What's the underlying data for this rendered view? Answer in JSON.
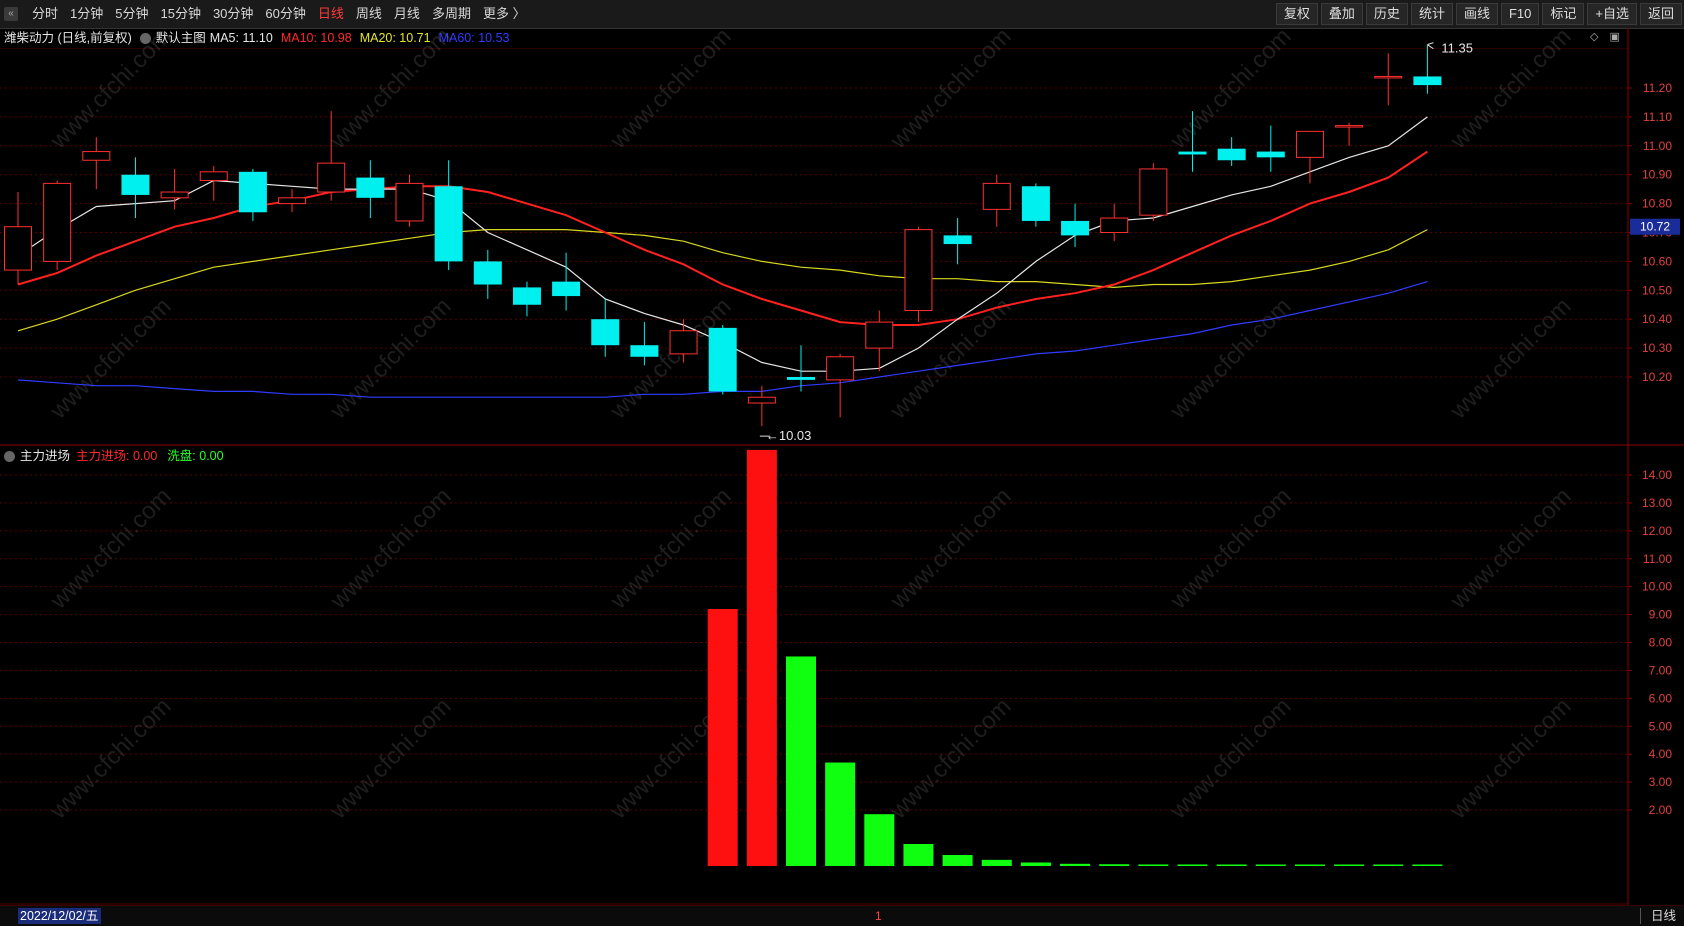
{
  "toolbar": {
    "periods": [
      "分时",
      "1分钟",
      "5分钟",
      "15分钟",
      "30分钟",
      "60分钟",
      "日线",
      "周线",
      "月线",
      "多周期",
      "更多 〉"
    ],
    "active_period": "日线",
    "buttons": [
      "复权",
      "叠加",
      "历史",
      "统计",
      "画线",
      "F10",
      "标记",
      "+自选",
      "返回"
    ]
  },
  "main_chart": {
    "title": "潍柴动力 (日线,前复权)",
    "indicator_name": "默认主图",
    "ma": [
      {
        "label": "MA5:",
        "value": "11.10",
        "color": "#e6e6e6"
      },
      {
        "label": "MA10:",
        "value": "10.98",
        "color": "#ff2a2a"
      },
      {
        "label": "MA20:",
        "value": "10.71",
        "color": "#e6e62a"
      },
      {
        "label": "MA60:",
        "value": "10.53",
        "color": "#2f3cff"
      }
    ],
    "y_ticks": [
      "11.20",
      "11.10",
      "11.00",
      "10.90",
      "10.80",
      "10.70",
      "10.60",
      "10.50",
      "10.40",
      "10.30",
      "10.20"
    ],
    "price_tag": "10.72",
    "high_label": "11.35",
    "low_label": "10.03"
  },
  "sub_chart": {
    "indicator_name": "主力进场",
    "series": [
      {
        "label": "主力进场:",
        "value": "0.00",
        "color": "#ff2a2a"
      },
      {
        "label": "洗盘:",
        "value": "0.00",
        "color": "#2aff2a"
      }
    ],
    "y_ticks": [
      "14.00",
      "13.00",
      "12.00",
      "11.00",
      "10.00",
      "9.00",
      "8.00",
      "7.00",
      "6.00",
      "5.00",
      "4.00",
      "3.00",
      "2.00"
    ]
  },
  "chart_data": {
    "type": "candlestick",
    "y_range": [
      10.03,
      11.35
    ],
    "candles": [
      {
        "o": 10.57,
        "h": 10.84,
        "l": 10.52,
        "c": 10.72
      },
      {
        "o": 10.6,
        "h": 10.88,
        "l": 10.57,
        "c": 10.87
      },
      {
        "o": 10.95,
        "h": 11.03,
        "l": 10.85,
        "c": 10.98
      },
      {
        "o": 10.9,
        "h": 10.96,
        "l": 10.75,
        "c": 10.83
      },
      {
        "o": 10.82,
        "h": 10.92,
        "l": 10.78,
        "c": 10.84
      },
      {
        "o": 10.88,
        "h": 10.93,
        "l": 10.81,
        "c": 10.91
      },
      {
        "o": 10.91,
        "h": 10.92,
        "l": 10.74,
        "c": 10.77
      },
      {
        "o": 10.8,
        "h": 10.85,
        "l": 10.77,
        "c": 10.82
      },
      {
        "o": 10.84,
        "h": 11.12,
        "l": 10.81,
        "c": 10.94
      },
      {
        "o": 10.89,
        "h": 10.95,
        "l": 10.75,
        "c": 10.82
      },
      {
        "o": 10.74,
        "h": 10.9,
        "l": 10.72,
        "c": 10.87
      },
      {
        "o": 10.86,
        "h": 10.95,
        "l": 10.57,
        "c": 10.6
      },
      {
        "o": 10.6,
        "h": 10.64,
        "l": 10.47,
        "c": 10.52
      },
      {
        "o": 10.51,
        "h": 10.53,
        "l": 10.41,
        "c": 10.45
      },
      {
        "o": 10.53,
        "h": 10.63,
        "l": 10.43,
        "c": 10.48
      },
      {
        "o": 10.4,
        "h": 10.47,
        "l": 10.27,
        "c": 10.31
      },
      {
        "o": 10.31,
        "h": 10.39,
        "l": 10.24,
        "c": 10.27
      },
      {
        "o": 10.28,
        "h": 10.4,
        "l": 10.25,
        "c": 10.36
      },
      {
        "o": 10.37,
        "h": 10.38,
        "l": 10.14,
        "c": 10.15
      },
      {
        "o": 10.11,
        "h": 10.17,
        "l": 10.03,
        "c": 10.13
      },
      {
        "o": 10.2,
        "h": 10.31,
        "l": 10.15,
        "c": 10.19
      },
      {
        "o": 10.19,
        "h": 10.28,
        "l": 10.06,
        "c": 10.27
      },
      {
        "o": 10.3,
        "h": 10.43,
        "l": 10.22,
        "c": 10.39
      },
      {
        "o": 10.43,
        "h": 10.72,
        "l": 10.39,
        "c": 10.71
      },
      {
        "o": 10.69,
        "h": 10.75,
        "l": 10.59,
        "c": 10.66
      },
      {
        "o": 10.78,
        "h": 10.9,
        "l": 10.72,
        "c": 10.87
      },
      {
        "o": 10.86,
        "h": 10.87,
        "l": 10.72,
        "c": 10.74
      },
      {
        "o": 10.74,
        "h": 10.8,
        "l": 10.65,
        "c": 10.69
      },
      {
        "o": 10.7,
        "h": 10.8,
        "l": 10.67,
        "c": 10.75
      },
      {
        "o": 10.76,
        "h": 10.94,
        "l": 10.74,
        "c": 10.92
      },
      {
        "o": 10.98,
        "h": 11.12,
        "l": 10.91,
        "c": 10.97
      },
      {
        "o": 10.99,
        "h": 11.03,
        "l": 10.93,
        "c": 10.95
      },
      {
        "o": 10.98,
        "h": 11.07,
        "l": 10.91,
        "c": 10.96
      },
      {
        "o": 10.96,
        "h": 11.05,
        "l": 10.87,
        "c": 11.05
      },
      {
        "o": 11.07,
        "h": 11.08,
        "l": 11.0,
        "c": 11.07
      },
      {
        "o": 11.24,
        "h": 11.32,
        "l": 11.14,
        "c": 11.24
      },
      {
        "o": 11.24,
        "h": 11.35,
        "l": 11.18,
        "c": 11.21
      }
    ],
    "ma5": [
      10.62,
      10.71,
      10.79,
      10.8,
      10.81,
      10.88,
      10.87,
      10.86,
      10.85,
      10.85,
      10.85,
      10.81,
      10.7,
      10.64,
      10.58,
      10.47,
      10.42,
      10.38,
      10.32,
      10.25,
      10.22,
      10.22,
      10.23,
      10.3,
      10.4,
      10.49,
      10.6,
      10.69,
      10.74,
      10.75,
      10.79,
      10.83,
      10.86,
      10.91,
      10.96,
      11.0,
      11.1
    ],
    "ma10": [
      10.52,
      10.56,
      10.62,
      10.67,
      10.72,
      10.75,
      10.79,
      10.81,
      10.84,
      10.85,
      10.86,
      10.86,
      10.84,
      10.8,
      10.76,
      10.7,
      10.64,
      10.59,
      10.52,
      10.47,
      10.43,
      10.39,
      10.38,
      10.38,
      10.4,
      10.44,
      10.47,
      10.49,
      10.52,
      10.57,
      10.63,
      10.69,
      10.74,
      10.8,
      10.84,
      10.89,
      10.98
    ],
    "ma20": [
      10.36,
      10.4,
      10.45,
      10.5,
      10.54,
      10.58,
      10.6,
      10.62,
      10.64,
      10.66,
      10.68,
      10.7,
      10.71,
      10.71,
      10.71,
      10.7,
      10.69,
      10.67,
      10.63,
      10.6,
      10.58,
      10.57,
      10.55,
      10.54,
      10.54,
      10.53,
      10.53,
      10.52,
      10.51,
      10.52,
      10.52,
      10.53,
      10.55,
      10.57,
      10.6,
      10.64,
      10.71
    ],
    "ma60": [
      10.19,
      10.18,
      10.17,
      10.17,
      10.16,
      10.15,
      10.15,
      10.14,
      10.14,
      10.13,
      10.13,
      10.13,
      10.13,
      10.13,
      10.13,
      10.13,
      10.14,
      10.14,
      10.15,
      10.15,
      10.17,
      10.18,
      10.2,
      10.22,
      10.24,
      10.26,
      10.28,
      10.29,
      10.31,
      10.33,
      10.35,
      10.38,
      10.4,
      10.43,
      10.46,
      10.49,
      10.53
    ],
    "sub_values": [
      0,
      0,
      0,
      0,
      0,
      0,
      0,
      0,
      0,
      0,
      0,
      0,
      0,
      0,
      0,
      0,
      0,
      0,
      9.2,
      14.9,
      7.5,
      3.7,
      1.85,
      1.0,
      0.5,
      0.28,
      0.16,
      0.1,
      0.08,
      0.07,
      0.07,
      0.06,
      0.06,
      0.06,
      0.06,
      0.06,
      0.06
    ],
    "sub_colors": [
      "r",
      "r",
      "r",
      "r",
      "r",
      "r",
      "r",
      "r",
      "r",
      "r",
      "r",
      "r",
      "r",
      "r",
      "r",
      "r",
      "r",
      "r",
      "r",
      "r",
      "g",
      "g",
      "g",
      "g",
      "g",
      "g",
      "g",
      "g",
      "g",
      "g",
      "g",
      "g",
      "g",
      "g",
      "g",
      "g",
      "g"
    ],
    "sub_y_range": [
      1.0,
      15.0
    ]
  },
  "status": {
    "date": "2022/12/02/五",
    "cursor_label": "1",
    "period_label": "日线"
  },
  "watermark": "www.cfchi.com"
}
